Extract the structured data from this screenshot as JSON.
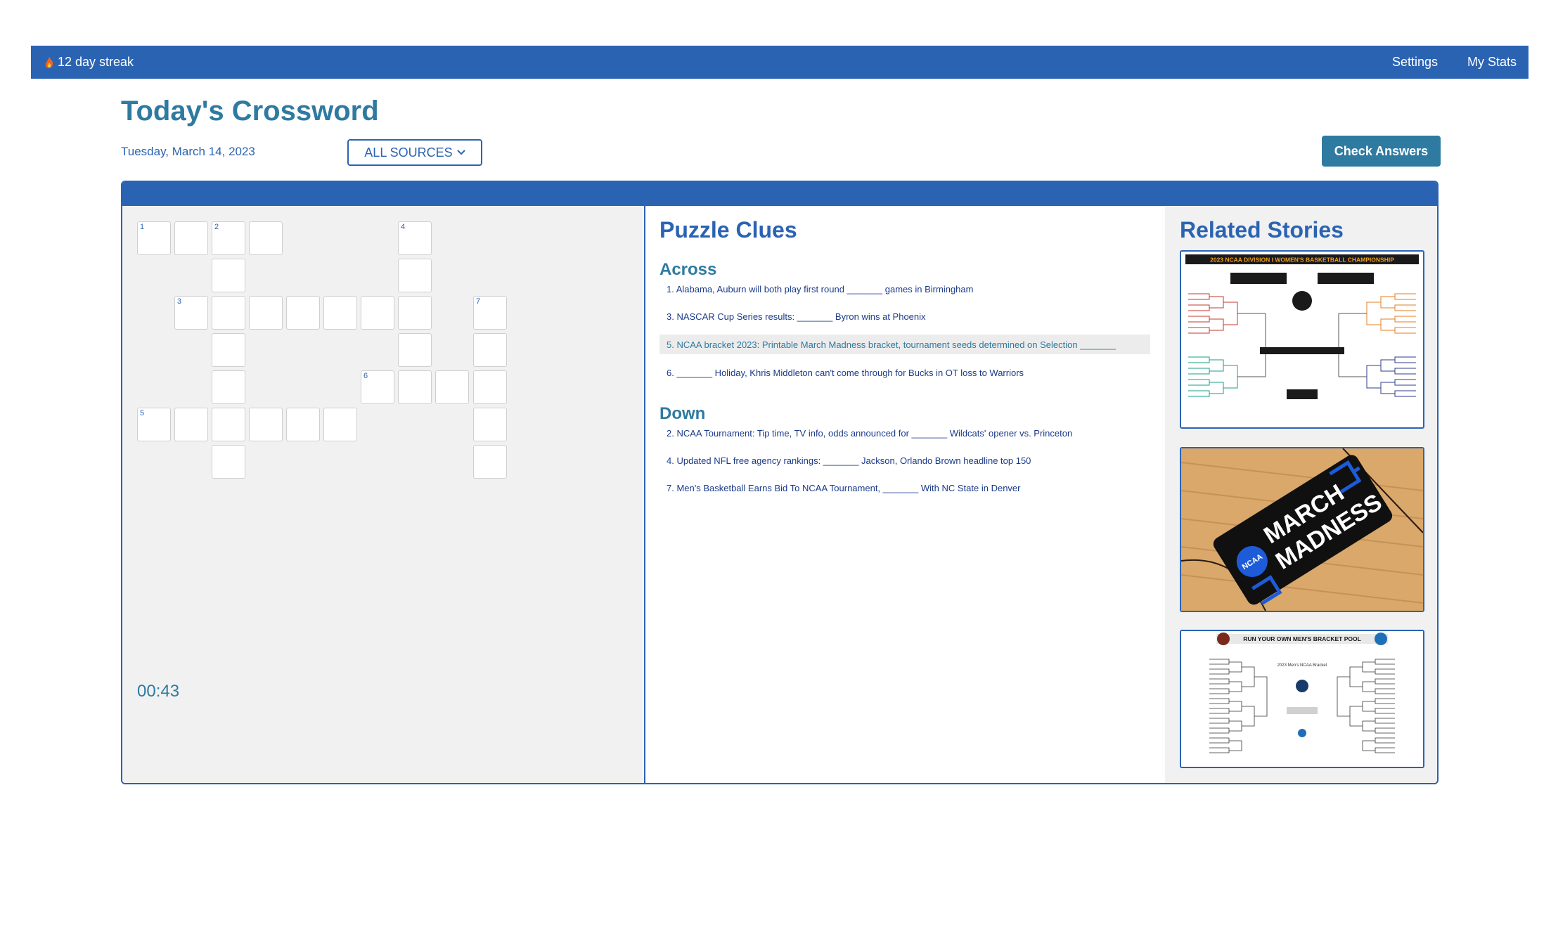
{
  "topbar": {
    "streak": "12 day streak",
    "settings": "Settings",
    "my_stats": "My Stats"
  },
  "header": {
    "title": "Today's Crossword",
    "date": "Tuesday, March 14, 2023",
    "sources_label": "ALL SOURCES",
    "check_label": "Check Answers"
  },
  "grid": {
    "timer": "00:43",
    "numbers": [
      "1",
      "2",
      "4",
      "3",
      "7",
      "6",
      "5"
    ]
  },
  "clues": {
    "heading": "Puzzle Clues",
    "across_label": "Across",
    "down_label": "Down",
    "across": [
      "1. Alabama, Auburn will both play first round _______ games in Birmingham",
      "3. NASCAR Cup Series results: _______ Byron wins at Phoenix",
      "5. NCAA bracket 2023: Printable March Madness bracket, tournament seeds determined on Selection _______",
      "6. _______ Holiday, Khris Middleton can't come through for Bucks in OT loss to Warriors"
    ],
    "down": [
      "2. NCAA Tournament: Tip time, TV info, odds announced for _______ Wildcats' opener vs. Princeton",
      "4. Updated NFL free agency rankings: _______ Jackson, Orlando Brown headline top 150",
      "7. Men's Basketball Earns Bid To NCAA Tournament, _______ With NC State in Denver"
    ]
  },
  "stories": {
    "heading": "Related Stories",
    "story1_banner": "2023 NCAA DIVISION I WOMEN'S BASKETBALL CHAMPIONSHIP",
    "story2_text_1": "MARCH",
    "story2_text_2": "MADNESS",
    "story2_logo": "NCAA",
    "story3_banner": "RUN YOUR OWN MEN'S BRACKET POOL",
    "story3_sub": "2023 Men's NCAA Bracket"
  },
  "colors": {
    "primary": "#2b63b3",
    "accent": "#2f7aa0",
    "panel_bg": "#f1f1f1"
  },
  "icons": {
    "streak": "flame-icon",
    "dropdown": "chevron-down-icon"
  }
}
